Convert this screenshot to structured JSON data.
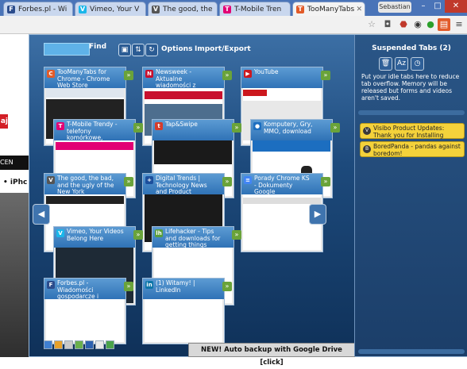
{
  "browser": {
    "tabs": [
      {
        "label": "Forbes.pl - Wi",
        "favicon": "F",
        "favicon_color": "#2b4c8c"
      },
      {
        "label": "Vimeo, Your V",
        "favicon": "V",
        "favicon_color": "#1ab7ea"
      },
      {
        "label": "The good, the",
        "favicon": "V",
        "favicon_color": "#555555"
      },
      {
        "label": "T-Mobile Tren",
        "favicon": "T",
        "favicon_color": "#e20074"
      },
      {
        "label": "TooManyTabs",
        "favicon": "T",
        "favicon_color": "#e25b29"
      }
    ],
    "user": "Sebastian",
    "window_controls": {
      "minimize": "–",
      "maximize": "□",
      "close": "✕"
    },
    "toolbar_icons": [
      "star-icon",
      "pocket-icon",
      "adblock-icon",
      "extension-icon",
      "green-circle-icon",
      "toomanytabs-icon",
      "menu-icon"
    ]
  },
  "background_page": {
    "red_label": "aj",
    "black_label": "CEN",
    "iphone_text": "• iPhc"
  },
  "toomanytabs": {
    "find_label": "Find",
    "search_value": "",
    "options_label": "Options",
    "import_export_label": "Import/Export",
    "tab_cards": [
      {
        "title": "TooManyTabs for Chrome - Chrome Web Store",
        "favicon": "C",
        "favicon_color": "#e25b29",
        "thumb": [
          "#dfe6ee",
          "#ffffff"
        ]
      },
      {
        "title": "Newsweek - Aktualne wiadomości z Polski i ze świata",
        "favicon": "N",
        "favicon_color": "#c8102e",
        "thumb": [
          "#c8102e",
          "#ffffff"
        ]
      },
      {
        "title": "YouTube",
        "favicon": "▶",
        "favicon_color": "#cc181e",
        "thumb": [
          "#f1f1f1",
          "#ffffff"
        ]
      },
      {
        "title": "T-Mobile Trendy - telefony komórkowe, tablety, smartfony",
        "favicon": "T",
        "favicon_color": "#e20074",
        "thumb": [
          "#e20074",
          "#ffffff"
        ]
      },
      {
        "title": "Tap&Swipe",
        "favicon": "t",
        "favicon_color": "#d43c2c",
        "thumb": [
          "#1a1a1a",
          "#ffffff"
        ]
      },
      {
        "title": "Komputery, Gry, MMO, download",
        "favicon": "●",
        "favicon_color": "#1c6ec0",
        "thumb": [
          "#1c6ec0",
          "#ffffff"
        ]
      },
      {
        "title": "The good, the bad, and the ugly of the New York Internet...",
        "favicon": "V",
        "favicon_color": "#555555",
        "thumb": [
          "#222222",
          "#ffffff"
        ]
      },
      {
        "title": "Digital Trends | Technology News and Product Reviews",
        "favicon": "+",
        "favicon_color": "#1c4f9c",
        "thumb": [
          "#1a1a1a",
          "#dddddd"
        ]
      },
      {
        "title": "Porady Chrome KS - Dokumenty Google",
        "favicon": "≡",
        "favicon_color": "#4285f4",
        "thumb": [
          "#f5f5f5",
          "#ffffff"
        ]
      },
      {
        "title": "Vimeo, Your Videos Belong Here",
        "favicon": "V",
        "favicon_color": "#1ab7ea",
        "thumb": [
          "#1e2a36",
          "#2a3a48"
        ]
      },
      {
        "title": "Lifehacker - Tips and downloads for getting things done",
        "favicon": "lh",
        "favicon_color": "#5a9e3c",
        "thumb": [
          "#ffffff",
          "#eeeeee"
        ]
      },
      {
        "title": "Forbes.pl - Wiadomości gospodarcze i finansowe",
        "favicon": "F",
        "favicon_color": "#2b4c8c",
        "thumb": [
          "#ffffff",
          "#f0f0f0"
        ]
      },
      {
        "title": "(1) Witamy! | LinkedIn",
        "favicon": "in",
        "favicon_color": "#0e76a8",
        "thumb": [
          "#ffffff",
          "#eef2f5"
        ]
      }
    ],
    "suspended": {
      "title": "Suspended Tabs (2)",
      "description": "Put your idle tabs here to reduce tab overflow. Memory will be released but forms and videos aren't saved.",
      "items": [
        {
          "label": "Visibo Product Updates: Thank you for Installing"
        },
        {
          "label": "BoredPanda - pandas against boredom!"
        }
      ]
    },
    "color_groups": [
      "#3f7fd1",
      "#e7a12a",
      "#c9c9c9",
      "#6ab04c",
      "#2c61b0",
      "#e8e8e8",
      "#4aa34a"
    ],
    "banner": "NEW! Auto backup with Google Drive [click]"
  }
}
